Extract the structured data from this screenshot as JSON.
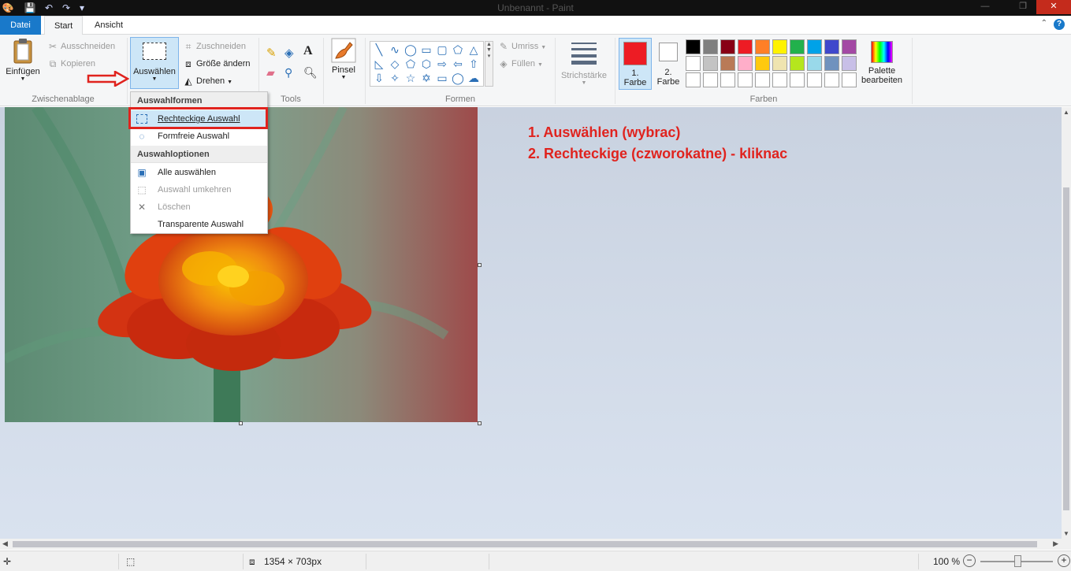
{
  "window": {
    "title": "Unbenannt - Paint",
    "controls": {
      "minimize": "—",
      "maximize": "❐",
      "close": "✕"
    }
  },
  "quick_access": {
    "save_icon": "💾",
    "undo_icon": "↶",
    "redo_icon": "↷",
    "customize_icon": "▾"
  },
  "tabs": [
    {
      "label": "Datei"
    },
    {
      "label": "Start"
    },
    {
      "label": "Ansicht"
    }
  ],
  "ribbon": {
    "clipboard": {
      "paste": "Einfügen",
      "cut": "Ausschneiden",
      "copy": "Kopieren",
      "group": "Zwischenablage"
    },
    "image": {
      "select": "Auswählen",
      "crop": "Zuschneiden",
      "resize": "Größe ändern",
      "rotate": "Drehen"
    },
    "tools": {
      "group": "Tools"
    },
    "brushes": {
      "label": "Pinsel"
    },
    "shapes": {
      "outline": "Umriss",
      "fill": "Füllen",
      "group": "Formen"
    },
    "stroke": {
      "label": "Strichstärke"
    },
    "colors": {
      "color1": "1. Farbe",
      "color2": "2. Farbe",
      "edit": "Palette bearbeiten",
      "group": "Farben",
      "color1_value": "#ed1c24",
      "color2_value": "#ffffff",
      "palette_row1": [
        "#000000",
        "#7f7f7f",
        "#880015",
        "#ed1c24",
        "#ff7f27",
        "#fff200",
        "#22b14c",
        "#00a2e8",
        "#3f48cc",
        "#a349a4"
      ],
      "palette_row2": [
        "#ffffff",
        "#c3c3c3",
        "#b97a57",
        "#ffaec9",
        "#ffc90e",
        "#efe4b0",
        "#b5e61d",
        "#99d9ea",
        "#7092be",
        "#c8bfe7"
      ],
      "palette_row3": [
        "#ffffff",
        "#ffffff",
        "#ffffff",
        "#ffffff",
        "#ffffff",
        "#ffffff",
        "#ffffff",
        "#ffffff",
        "#ffffff",
        "#ffffff"
      ]
    }
  },
  "dropdown": {
    "section1": "Auswahlformen",
    "rect_select": "Rechteckige Auswahl",
    "free_select": "Formfreie Auswahl",
    "section2": "Auswahloptionen",
    "select_all": "Alle auswählen",
    "invert": "Auswahl umkehren",
    "delete": "Löschen",
    "transparent": "Transparente Auswahl"
  },
  "annotations": {
    "line1": "1. Auswählen (wybrac)",
    "line2": "2. Rechteckige (czworokatne) - kliknac"
  },
  "statusbar": {
    "image_size": "1354 × 703px",
    "zoom": "100 %"
  }
}
